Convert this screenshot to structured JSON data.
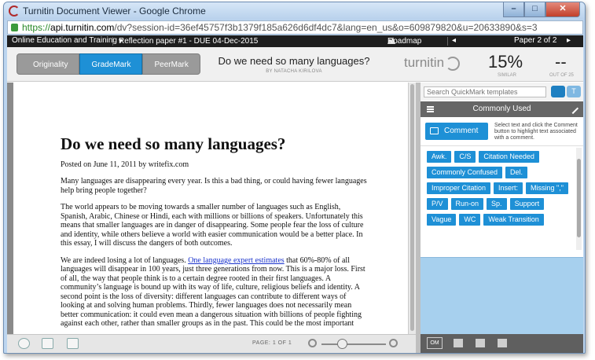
{
  "window": {
    "title": "Turnitin Document Viewer - Google Chrome",
    "buttons": {
      "minimize": "–",
      "maximize": "□",
      "close": "✕"
    }
  },
  "address": {
    "scheme": "https://",
    "host": "api.turnitin.com",
    "path": "/dv?session-id=36ef45757f3b1379f185a626d6df4dc7&lang=en_us&o=609879820&u=20633890&s=3"
  },
  "topnav": {
    "class_name": "Online Education and Training",
    "assignment": "Reflection paper #1 - DUE 04-Dec-2015",
    "assignment_caret": "▾",
    "roadmap": "Roadmap",
    "prev": "◂",
    "page": "Paper 2 of 2",
    "next": "▸"
  },
  "header": {
    "modes": [
      "Originality",
      "GradeMark",
      "PeerMark"
    ],
    "active_mode": "GradeMark",
    "doc_title": "Do we need so many languages?",
    "doc_author": "BY NATACHA KIRILOVA",
    "logo": "turnitin",
    "similarity": "15%",
    "similarity_label": "SIMILAR",
    "grade": "--",
    "grade_label": "OUT OF 25"
  },
  "essay": {
    "title": "Do we need so many languages?",
    "posted": "Posted on June 11, 2011 by writefix.com",
    "p1": "Many languages are disappearing every year. Is this a bad thing, or could having fewer languages help bring people together?",
    "p2": "The world appears to be moving towards a smaller number of languages such as English, Spanish, Arabic, Chinese or Hindi, each with millions or billions of speakers. Unfortunately this means that smaller languages are in danger of disappearing. Some people fear the loss of culture and identity, while others believe a world with easier communication would be a better place. In this essay, I will discuss the dangers of both outcomes.",
    "p3_before": "We are indeed losing a lot of languages. ",
    "p3_link": "One language expert estimates",
    "p3_after": " that 60%-80% of all languages will disappear in 100 years, just three generations from now. This is a major loss. First of all, the way that people think is to a certain degree rooted in their first languages. A community’s language is bound up with its way of life, culture, religious beliefs and identity. A second point is the loss of diversity: different languages can contribute to different ways of looking at and solving human problems. Thirdly, fewer languages does not necessarily mean better communication: it could even mean a dangerous situation with billions of people fighting against each other, rather than smaller groups as in the past. This could be the most important"
  },
  "bottombar": {
    "page_label": "PAGE:",
    "page_value": "1 OF 1",
    "zoom_level": 0.25
  },
  "sidepanel": {
    "search_placeholder": "Search QuickMark templates",
    "toggle_text": "T",
    "set_name": "Commonly Used",
    "comment_button": "Comment",
    "comment_help": "Select text and click the Comment button to highlight text associated with a comment.",
    "quickmarks": [
      "Awk.",
      "C/S",
      "Citation Needed",
      "Commonly Confused",
      "Del.",
      "Improper Citation",
      "Insert:",
      "Missing \",\"",
      "P/V",
      "Run-on",
      "Sp.",
      "Support",
      "Vague",
      "WC",
      "Weak Transition"
    ],
    "bottom_om": "OM"
  },
  "colors": {
    "accent": "#1e90d6",
    "side_empty": "#a7d0ee"
  }
}
